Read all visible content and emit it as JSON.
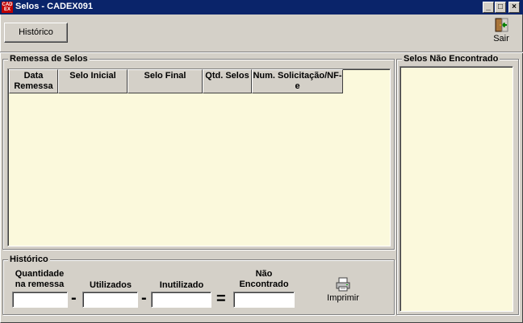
{
  "window": {
    "title": "Selos - CADEX091",
    "app_icon_text": "CAD EX",
    "controls": {
      "minimize": "_",
      "maximize": "□",
      "close": "×"
    }
  },
  "toolbar": {
    "historico_button": "Histórico",
    "sair_label": "Sair"
  },
  "remessa": {
    "title": "Remessa de Selos",
    "columns": [
      "Data Remessa",
      "Selo Inicial",
      "Selo Final",
      "Qtd. Selos",
      "Num. Solicitação/NF-e"
    ]
  },
  "nao_encontrado": {
    "title": "Selos Não Encontrado"
  },
  "historico": {
    "title": "Histórico",
    "labels": {
      "quantidade": "Quantidade na remessa",
      "utilizados": "Utilizados",
      "inutilizado": "Inutilizado",
      "nao_encontrado": "Não Encontrado"
    },
    "operators": {
      "minus1": "-",
      "minus2": "-",
      "equals": "="
    },
    "fields": {
      "quantidade": "",
      "utilizados": "",
      "inutilizado": "",
      "nao_encontrado": ""
    },
    "imprimir_label": "Imprimir"
  }
}
